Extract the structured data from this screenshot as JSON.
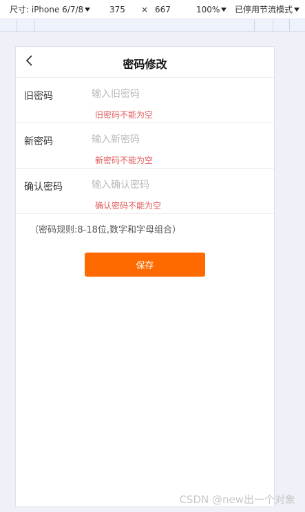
{
  "devtools": {
    "device_label": "尺寸: iPhone 6/7/8",
    "width": "375",
    "times": "×",
    "height": "667",
    "zoom": "100%",
    "throttle": "已停用节流模式"
  },
  "header": {
    "title": "密码修改",
    "back_icon": "chevron-left-icon"
  },
  "form": {
    "old": {
      "label": "旧密码",
      "placeholder": "输入旧密码",
      "value": "",
      "error": "旧密码不能为空"
    },
    "new": {
      "label": "新密码",
      "placeholder": "输入新密码",
      "value": "",
      "error": "新密码不能为空"
    },
    "confirm": {
      "label": "确认密码",
      "placeholder": "输入确认密码",
      "value": "",
      "error": "确认密码不能为空"
    }
  },
  "rules": "（密码规则:8-18位,数字和字母组合）",
  "save_label": "保存",
  "watermark": "CSDN @new出一个对象",
  "colors": {
    "accent": "#ff6a00",
    "error": "#e05a5a",
    "placeholder": "#b8b8b8"
  }
}
